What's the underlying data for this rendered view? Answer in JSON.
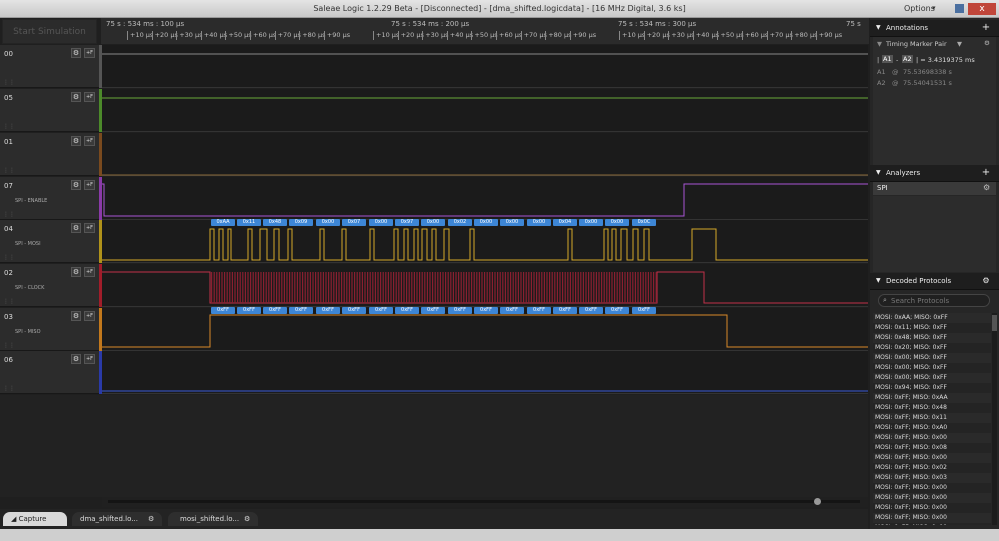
{
  "window": {
    "title": "Saleae Logic 1.2.29 Beta - [Disconnected] - [dma_shifted.logicdata] - [16 MHz Digital, 3.6 ks]",
    "options_label": "Options",
    "close_label": "x"
  },
  "toolbar": {
    "start_simulation": "Start Simulation"
  },
  "ruler": {
    "group_titles": [
      "75 s : 534 ms : 100 μs",
      "75 s : 534 ms : 200 μs",
      "75 s : 534 ms : 300 μs",
      "75 s"
    ],
    "ticks": [
      "+10 μs",
      "+20 μs",
      "+30 μs",
      "+40 μs",
      "+50 μs",
      "+60 μs",
      "+70 μs",
      "+80 μs",
      "+90 μs"
    ]
  },
  "channels": [
    {
      "number": "00",
      "name": "",
      "color": "#555555"
    },
    {
      "number": "05",
      "name": "",
      "color": "#4c8a2a"
    },
    {
      "number": "01",
      "name": "",
      "color": "#7a4a1e"
    },
    {
      "number": "07",
      "name": "SPI - ENABLE",
      "color": "#8a3aa8"
    },
    {
      "number": "04",
      "name": "SPI - MOSI",
      "color": "#b0921a"
    },
    {
      "number": "02",
      "name": "SPI - CLOCK",
      "color": "#a11d2a"
    },
    {
      "number": "03",
      "name": "SPI - MISO",
      "color": "#c2781c"
    },
    {
      "number": "06",
      "name": "",
      "color": "#2a3aa8"
    }
  ],
  "mosi_bytes": [
    "0xAA",
    "0x11",
    "0x48",
    "0x09",
    "0x00",
    "0x07",
    "0x00",
    "0x97",
    "0x00",
    "0x02",
    "0x00",
    "0x00",
    "0x00",
    "0x04",
    "0x00",
    "0x00",
    "0x0C"
  ],
  "miso_bytes": [
    "0xFF",
    "0xFF",
    "0xFF",
    "0xFF",
    "0xFF",
    "0xFF",
    "0xFF",
    "0xFF",
    "0xFF",
    "0xFF",
    "0xFF",
    "0xFF",
    "0xFF",
    "0xFF",
    "0xFF",
    "0xFF",
    "0xFF"
  ],
  "tabs": {
    "capture": "Capture",
    "file1": "dma_shifted.lo...",
    "file2": "mosi_shifted.lo..."
  },
  "annotations": {
    "header": "Annotations",
    "marker_pair": "Timing Marker Pair",
    "delta_a1": "A1",
    "delta_sep": "-",
    "delta_a2": "A2",
    "delta_value": "| = 3.4319375 ms",
    "a1_label": "A1",
    "a1_at": "@",
    "a1_time": "75.53698338 s",
    "a2_label": "A2",
    "a2_at": "@",
    "a2_time": "75.54041531 s"
  },
  "analyzers": {
    "header": "Analyzers",
    "items": [
      "SPI"
    ]
  },
  "decoded": {
    "header": "Decoded Protocols",
    "search_placeholder": "Search Protocols",
    "rows": [
      "MOSI: 0xAA;  MISO: 0xFF",
      "MOSI: 0x11;  MISO: 0xFF",
      "MOSI: 0x48;  MISO: 0xFF",
      "MOSI: 0x20;  MISO: 0xFF",
      "MOSI: 0x00;  MISO: 0xFF",
      "MOSI: 0x00;  MISO: 0xFF",
      "MOSI: 0x00;  MISO: 0xFF",
      "MOSI: 0x94;  MISO: 0xFF",
      "MOSI: 0xFF;  MISO: 0xAA",
      "MOSI: 0xFF;  MISO: 0x48",
      "MOSI: 0xFF;  MISO: 0x11",
      "MOSI: 0xFF;  MISO: 0xA0",
      "MOSI: 0xFF;  MISO: 0x00",
      "MOSI: 0xFF;  MISO: 0x08",
      "MOSI: 0xFF;  MISO: 0x00",
      "MOSI: 0xFF;  MISO: 0x02",
      "MOSI: 0xFF;  MISO: 0x03",
      "MOSI: 0xFF;  MISO: 0x00",
      "MOSI: 0xFF;  MISO: 0x00",
      "MOSI: 0xFF;  MISO: 0x00",
      "MOSI: 0xFF;  MISO: 0x00",
      "MOSI: 0xFF;  MISO: 0x00"
    ]
  },
  "colors": {
    "accent_blue": "#3d86d6",
    "close_red": "#c0463a"
  }
}
